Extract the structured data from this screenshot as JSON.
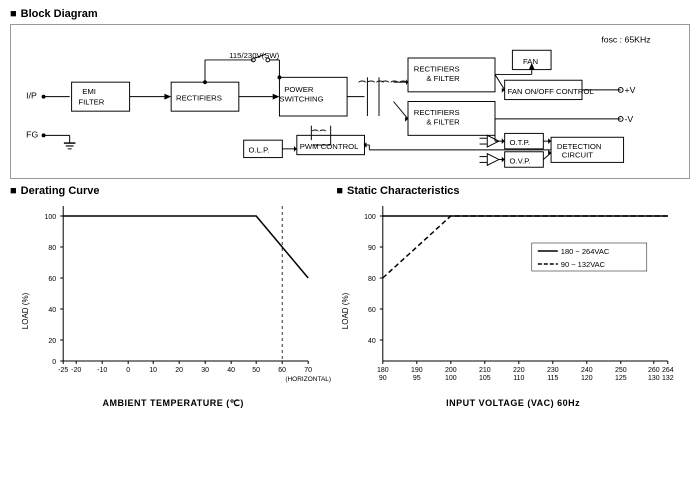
{
  "page": {
    "block_diagram_title": "Block Diagram",
    "derating_curve_title": "Derating Curve",
    "static_characteristics_title": "Static Characteristics",
    "derating_x_label": "AMBIENT TEMPERATURE (℃)",
    "static_x_label": "INPUT VOLTAGE (VAC) 60Hz",
    "y_label": "LOAD (%)",
    "fosc_label": "fosc : 65KHz",
    "legend_solid": "180 ~ 264VAC",
    "legend_dashed": "90 ~ 132VAC",
    "derating_x_ticks": [
      "-25",
      "-20",
      "-10",
      "0",
      "10",
      "20",
      "30",
      "40",
      "50",
      "60",
      "70"
    ],
    "derating_x_sub": "(HORIZONTAL)",
    "static_x_ticks_top": [
      "90",
      "95",
      "100",
      "105",
      "110",
      "115",
      "120",
      "125",
      "130",
      "132"
    ],
    "static_x_ticks_bottom": [
      "180",
      "190",
      "200",
      "210",
      "220",
      "230",
      "240",
      "250",
      "260",
      "264"
    ]
  }
}
